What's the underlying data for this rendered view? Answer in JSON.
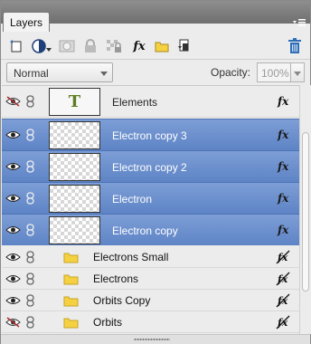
{
  "panel": {
    "tab_label": "Layers",
    "menu_icon": "panel-menu-icon"
  },
  "toolbar": {
    "new_layer_icon": "new-layer-icon",
    "adjustment_icon": "adjustment-layer-icon",
    "mask_icon": "layer-mask-icon",
    "lock_icon": "lock-icon",
    "lock_transparent_icon": "lock-transparency-icon",
    "fx_label": "fx",
    "folder_icon": "new-group-icon",
    "link_icon": "link-layers-icon",
    "trash_icon": "trash-icon"
  },
  "blend": {
    "mode": "Normal",
    "opacity_label": "Opacity:",
    "opacity_value": "100%"
  },
  "layers": [
    {
      "name": "Elements",
      "type": "text",
      "thumb_letter": "T",
      "visible": false,
      "selected": false,
      "fx": "fx"
    },
    {
      "name": "Electron copy 3",
      "type": "image",
      "visible": true,
      "selected": true,
      "fx": "fx"
    },
    {
      "name": "Electron copy 2",
      "type": "image",
      "visible": true,
      "selected": true,
      "fx": "fx"
    },
    {
      "name": "Electron",
      "type": "image",
      "visible": true,
      "selected": true,
      "fx": "fx"
    },
    {
      "name": "Electron copy",
      "type": "image",
      "visible": true,
      "selected": true,
      "fx": "fx"
    },
    {
      "name": "Electrons Small",
      "type": "group",
      "visible": true,
      "selected": false
    },
    {
      "name": "Electrons",
      "type": "group",
      "visible": true,
      "selected": false
    },
    {
      "name": "Orbits Copy",
      "type": "group",
      "visible": true,
      "selected": false
    },
    {
      "name": "Orbits",
      "type": "group",
      "visible": false,
      "selected": false
    }
  ],
  "colors": {
    "selection": "#6b8fcf",
    "folder": "#f5d142",
    "text_thumb": "#5f7d25",
    "hidden_slash": "#b03030",
    "trash": "#2f6fb7"
  }
}
